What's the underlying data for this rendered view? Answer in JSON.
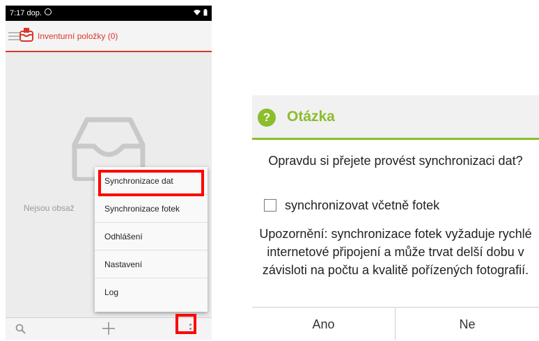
{
  "phone": {
    "status": {
      "time": "7:17 dop.",
      "icons": "wifi-icon battery-icon"
    },
    "appbar": {
      "title": "Inventurní položky (0)",
      "accent": "#d9362b"
    },
    "empty_text": "Nejsou obsaž",
    "menu": {
      "items": [
        {
          "label": "Synchronizace dat"
        },
        {
          "label": "Synchronizace fotek"
        },
        {
          "label": "Odhlášení"
        },
        {
          "label": "Nastavení"
        },
        {
          "label": "Log"
        }
      ],
      "highlighted": "Synchronizace dat"
    },
    "bottom": {
      "icons": [
        "search-icon",
        "add-icon",
        "more-vert-icon"
      ]
    }
  },
  "dialog": {
    "title": "Otázka",
    "accent": "#8bbd2c",
    "question": "Opravdu si přejete provést synchronizaci dat?",
    "checkbox_label": "synchronizovat včetně fotek",
    "checkbox_checked": false,
    "warning": "Upozornění: synchronizace fotek vyžaduje rychlé internetové připojení a může trvat delší dobu v závisloti na počtu a kvalitě pořízených fotografií.",
    "buttons": {
      "yes": "Ano",
      "no": "Ne"
    }
  }
}
